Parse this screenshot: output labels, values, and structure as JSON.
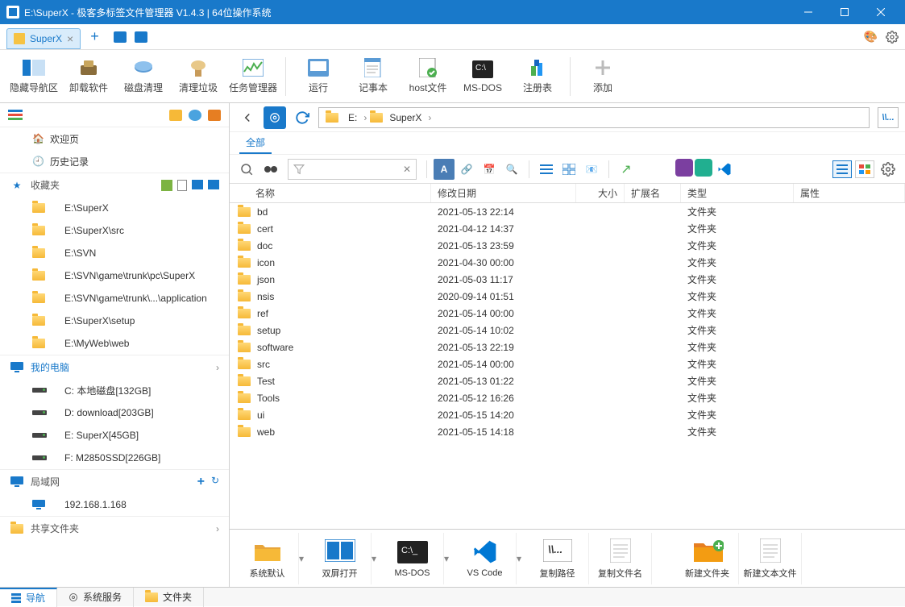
{
  "title": "E:\\SuperX - 极客多标签文件管理器 V1.4.3  |  64位操作系统",
  "tab": {
    "label": "SuperX"
  },
  "toolbar": [
    {
      "label": "隐藏导航区"
    },
    {
      "label": "卸载软件"
    },
    {
      "label": "磁盘清理"
    },
    {
      "label": "清理垃圾"
    },
    {
      "label": "任务管理器"
    },
    {
      "label": "运行"
    },
    {
      "label": "记事本"
    },
    {
      "label": "host文件"
    },
    {
      "label": "MS-DOS"
    },
    {
      "label": "注册表"
    },
    {
      "label": "添加"
    }
  ],
  "sidebar": {
    "welcome": "欢迎页",
    "history": "历史记录",
    "favorites_title": "收藏夹",
    "favorites": [
      "E:\\SuperX",
      "E:\\SuperX\\src",
      "E:\\SVN",
      "E:\\SVN\\game\\trunk\\pc\\SuperX",
      "E:\\SVN\\game\\trunk\\...\\application",
      "E:\\SuperX\\setup",
      "E:\\MyWeb\\web"
    ],
    "computer_title": "我的电脑",
    "drives": [
      "C: 本地磁盘[132GB]",
      "D: download[203GB]",
      "E: SuperX[45GB]",
      "F: M2850SSD[226GB]"
    ],
    "lan_title": "局域网",
    "lan_items": [
      "192.168.1.168"
    ],
    "share_title": "共享文件夹"
  },
  "breadcrumb": {
    "drive": "E:",
    "folder": "SuperX"
  },
  "filter_all": "全部",
  "columns": {
    "name": "名称",
    "date": "修改日期",
    "size": "大小",
    "ext": "扩展名",
    "type": "类型",
    "attr": "属性"
  },
  "type_folder": "文件夹",
  "files": [
    {
      "name": "bd",
      "date": "2021-05-13 22:14"
    },
    {
      "name": "cert",
      "date": "2021-04-12 14:37"
    },
    {
      "name": "doc",
      "date": "2021-05-13 23:59"
    },
    {
      "name": "icon",
      "date": "2021-04-30 00:00"
    },
    {
      "name": "json",
      "date": "2021-05-03 11:17"
    },
    {
      "name": "nsis",
      "date": "2020-09-14 01:51"
    },
    {
      "name": "ref",
      "date": "2021-05-14 00:00"
    },
    {
      "name": "setup",
      "date": "2021-05-14 10:02"
    },
    {
      "name": "software",
      "date": "2021-05-13 22:19"
    },
    {
      "name": "src",
      "date": "2021-05-14 00:00"
    },
    {
      "name": "Test",
      "date": "2021-05-13 01:22"
    },
    {
      "name": "Tools",
      "date": "2021-05-12 16:26"
    },
    {
      "name": "ui",
      "date": "2021-05-15 14:20"
    },
    {
      "name": "web",
      "date": "2021-05-15 14:18"
    }
  ],
  "bottombar": [
    "系统默认",
    "双屏打开",
    "MS-DOS",
    "VS Code",
    "复制路径",
    "复制文件名",
    "新建文件夹",
    "新建文本文件"
  ],
  "status_tabs": [
    "导航",
    "系统服务",
    "文件夹"
  ],
  "small_box": "\\\\..."
}
